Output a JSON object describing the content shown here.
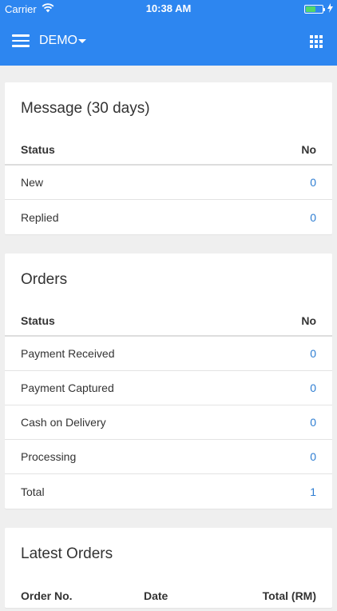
{
  "status_bar": {
    "carrier": "Carrier",
    "time": "10:38 AM"
  },
  "navbar": {
    "brand": "DEMO"
  },
  "messages": {
    "title": "Message (30 days)",
    "col_status": "Status",
    "col_no": "No",
    "rows": [
      {
        "label": "New",
        "value": "0"
      },
      {
        "label": "Replied",
        "value": "0"
      }
    ]
  },
  "orders": {
    "title": "Orders",
    "col_status": "Status",
    "col_no": "No",
    "rows": [
      {
        "label": "Payment Received",
        "value": "0"
      },
      {
        "label": "Payment Captured",
        "value": "0"
      },
      {
        "label": "Cash on Delivery",
        "value": "0"
      },
      {
        "label": "Processing",
        "value": "0"
      },
      {
        "label": "Total",
        "value": "1"
      }
    ]
  },
  "latest_orders": {
    "title": "Latest Orders",
    "col_order_no": "Order No.",
    "col_date": "Date",
    "col_total": "Total (RM)"
  },
  "colors": {
    "primary": "#2d86f0",
    "link": "#2d7dd2",
    "background": "#efefef"
  }
}
